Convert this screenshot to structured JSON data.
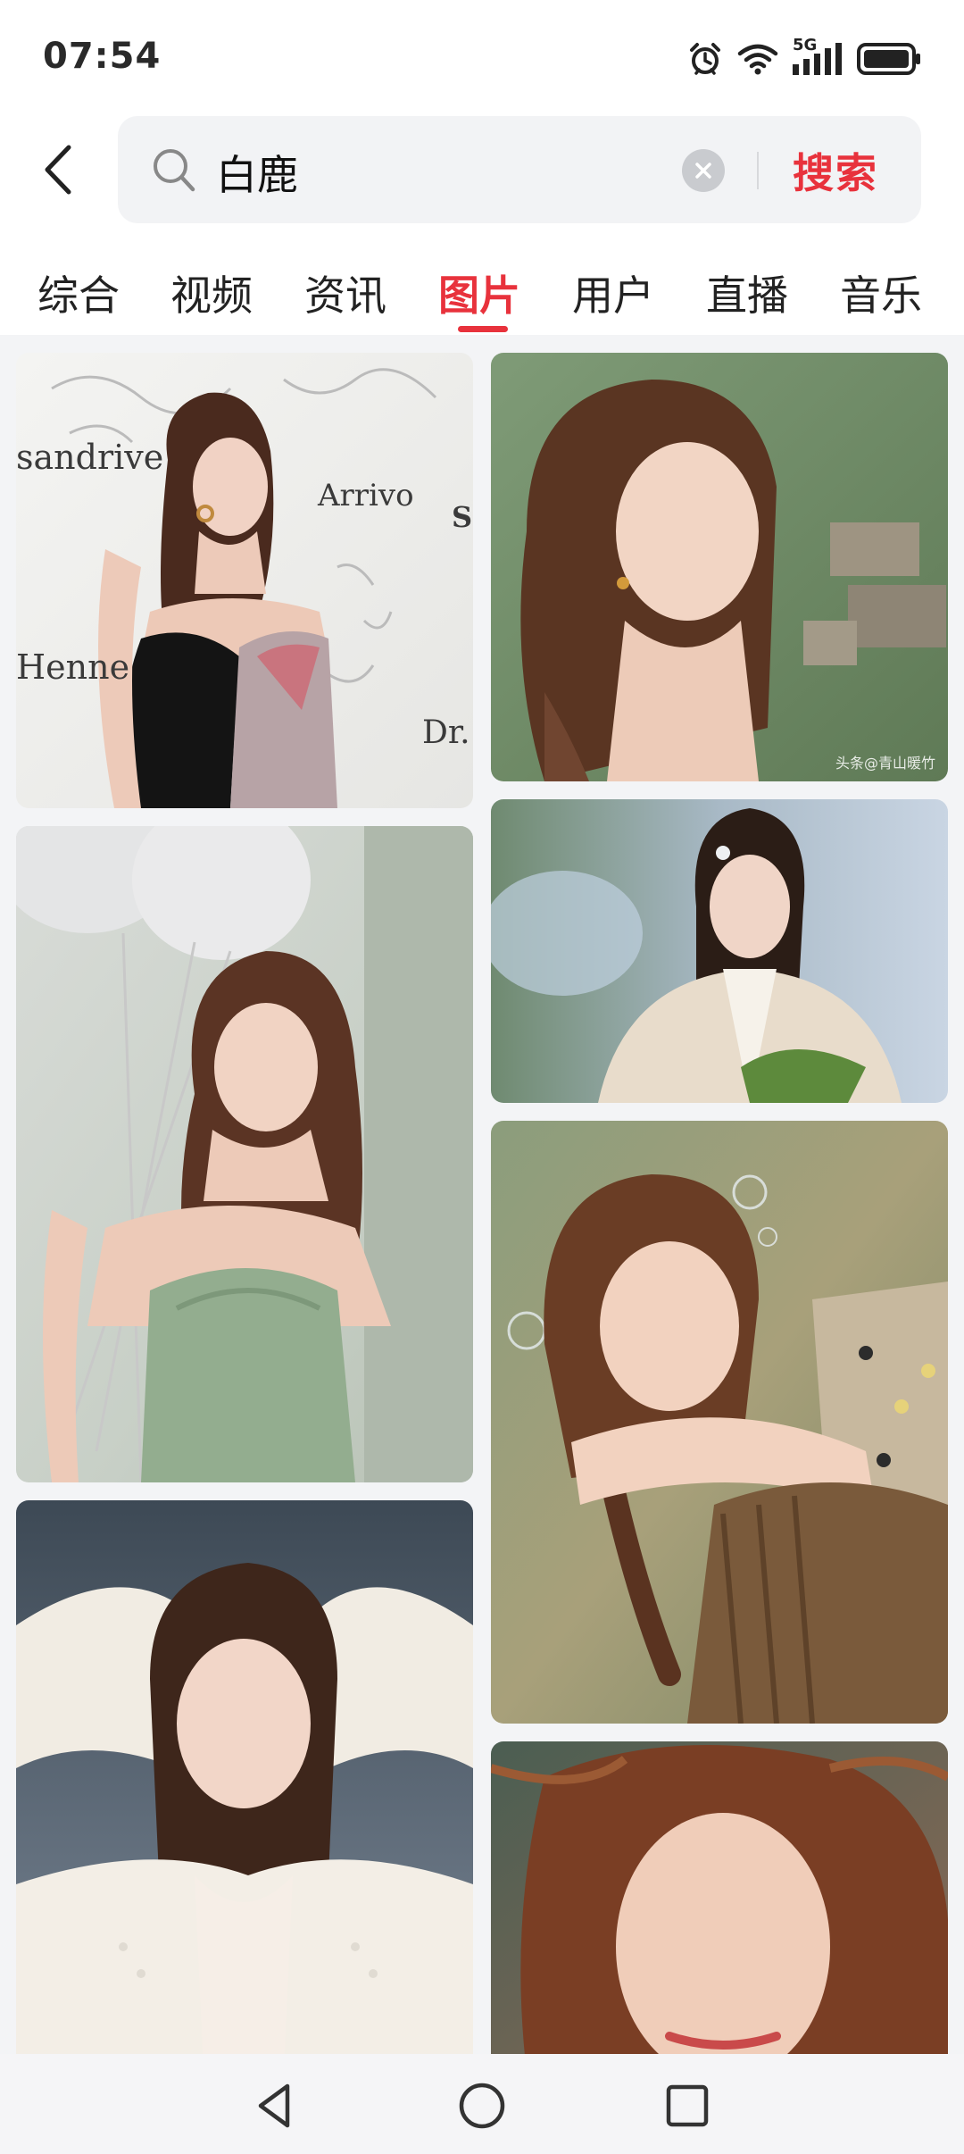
{
  "status_bar": {
    "time": "07:54",
    "network": "5G",
    "icons": [
      "alarm-icon",
      "wifi-icon",
      "signal-icon",
      "battery-icon"
    ]
  },
  "search": {
    "query": "白鹿",
    "submit_label": "搜索"
  },
  "tabs": [
    {
      "label": "综合",
      "active": false
    },
    {
      "label": "视频",
      "active": false
    },
    {
      "label": "资讯",
      "active": false
    },
    {
      "label": "图片",
      "active": true
    },
    {
      "label": "用户",
      "active": false
    },
    {
      "label": "直播",
      "active": false
    },
    {
      "label": "音乐",
      "active": false
    }
  ],
  "results": {
    "left_column": [
      {
        "description": "red carpet portrait in black strapless gown",
        "wall_text": [
          "sandrive",
          "Arrivo",
          "Henne",
          "Dr.",
          "S"
        ]
      },
      {
        "description": "portrait in green corset dress with white balloons"
      },
      {
        "description": "portrait in white knit cardigan, arms raised"
      }
    ],
    "right_column": [
      {
        "description": "outdoor portrait with braided hair, village background",
        "watermark": "头条@青山暖竹"
      },
      {
        "description": "costume portrait in white hanfu with flowers"
      },
      {
        "description": "portrait leaning on wooden railing, floral top, bubbles"
      },
      {
        "description": "close-up portrait with wind-swept hair"
      }
    ]
  },
  "nav_bar": {
    "buttons": [
      "back-triangle-icon",
      "home-circle-icon",
      "recents-square-icon"
    ]
  },
  "colors": {
    "accent": "#e8323c",
    "search_bg": "#f2f3f5",
    "grid_bg": "#f3f4f6"
  }
}
